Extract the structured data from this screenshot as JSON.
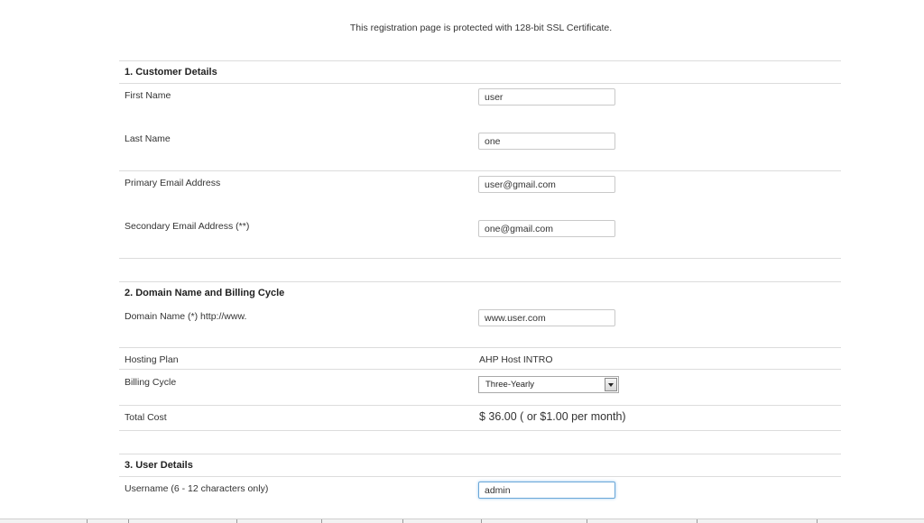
{
  "notice": "This registration page is protected with 128-bit SSL Certificate.",
  "customer_details": {
    "title": "1. Customer Details",
    "first_name": {
      "label": "First Name",
      "value": "user"
    },
    "last_name": {
      "label": "Last Name",
      "value": "one"
    },
    "primary_email": {
      "label": "Primary Email Address",
      "value": "user@gmail.com"
    },
    "secondary_email": {
      "label": "Secondary Email Address (**)",
      "value": "one@gmail.com"
    }
  },
  "domain_billing": {
    "title": "2. Domain Name and Billing Cycle",
    "domain_name": {
      "label": "Domain Name (*) http://www.",
      "value": "www.user.com"
    },
    "hosting_plan": {
      "label": "Hosting Plan",
      "value": "AHP Host INTRO"
    },
    "billing_cycle": {
      "label": "Billing Cycle",
      "selected": "Three-Yearly"
    },
    "total_cost": {
      "label": "Total Cost",
      "value": "$ 36.00 ( or $1.00 per month)"
    }
  },
  "user_details": {
    "title": "3. User Details",
    "username": {
      "label": "Username (6 - 12 characters only)",
      "value": "admin"
    }
  },
  "icons": {
    "select_arrow": "chevron-down-icon"
  }
}
